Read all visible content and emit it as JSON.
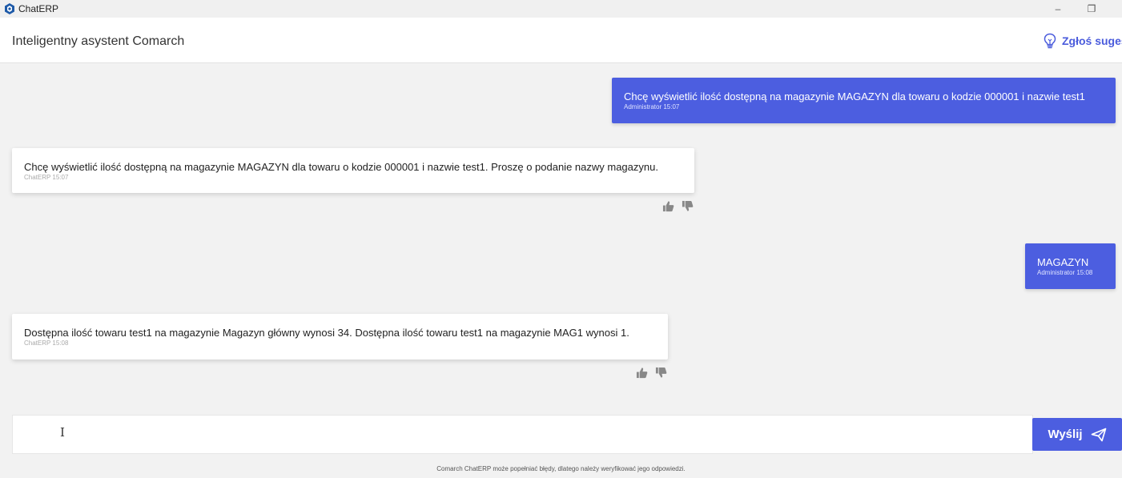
{
  "window": {
    "app_name": "ChatERP",
    "minimize_glyph": "–",
    "restore_glyph": "❐",
    "logo_icon": "chaterp-logo-icon"
  },
  "header": {
    "title": "Inteligentny asystent Comarch",
    "suggest_label": "Zgłoś suges",
    "suggest_icon": "lightbulb-icon"
  },
  "messages": [
    {
      "role": "user",
      "text": "Chcę wyświetlić ilość dostępną na magazynie MAGAZYN dla towaru o kodzie 000001 i nazwie test1",
      "meta": "Administrator 15:07"
    },
    {
      "role": "assistant",
      "text": "Chcę wyświetlić ilość dostępną na magazynie MAGAZYN dla towaru o kodzie 000001 i nazwie test1. Proszę o podanie nazwy magazynu.",
      "meta": "ChatERP 15:07"
    },
    {
      "role": "user",
      "text": "MAGAZYN",
      "meta": "Administrator 15:08"
    },
    {
      "role": "assistant",
      "text": "Dostępna ilość towaru test1 na magazynie Magazyn główny wynosi 34. Dostępna ilość towaru test1 na magazynie MAG1 wynosi 1.",
      "meta": "ChatERP 15:08"
    }
  ],
  "composer": {
    "value": "",
    "placeholder": "",
    "send_label": "Wyślij",
    "send_icon": "paper-plane-icon"
  },
  "footer": {
    "disclaimer": "Comarch ChatERP może popełniać błędy, dlatego należy weryfikować jego odpowiedzi."
  },
  "colors": {
    "accent": "#4c5ee0",
    "background": "#f2f2f2",
    "bubble_bot": "#ffffff"
  }
}
